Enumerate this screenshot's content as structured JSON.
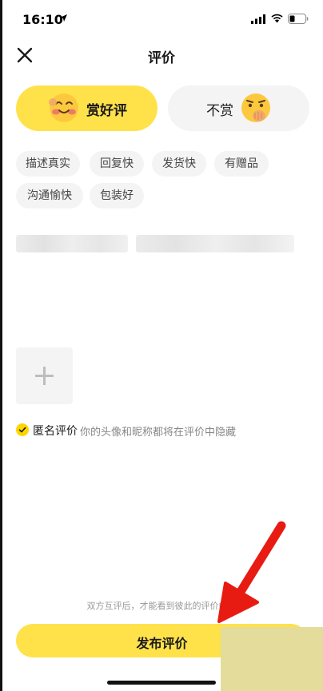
{
  "status_bar": {
    "time": "16:10",
    "icons": [
      "location-arrow-icon",
      "signal-icon",
      "wifi-icon",
      "battery-icon"
    ]
  },
  "nav": {
    "title": "评价",
    "close_icon": "close-icon"
  },
  "rating": {
    "good_label": "赏好评",
    "bad_label": "不赏",
    "good_icon": "blushing-smile-emoji",
    "bad_icon": "shushing-face-emoji",
    "selected": "good"
  },
  "tags": [
    "描述真实",
    "回复快",
    "发货快",
    "有赠品",
    "沟通愉快",
    "包装好"
  ],
  "photo": {
    "icon": "plus-icon"
  },
  "anonymous": {
    "checked": true,
    "label": "匿名评价",
    "hint": "你的头像和昵称都将在评价中隐藏"
  },
  "mutual_hint": "双方互评后，才能看到彼此的评价内容",
  "submit": {
    "label": "发布评价"
  },
  "colors": {
    "accent_yellow": "#ffe24a",
    "check_yellow": "#ffd500",
    "chip_bg": "#f4f4f4",
    "annotation_red": "#e81b12"
  }
}
